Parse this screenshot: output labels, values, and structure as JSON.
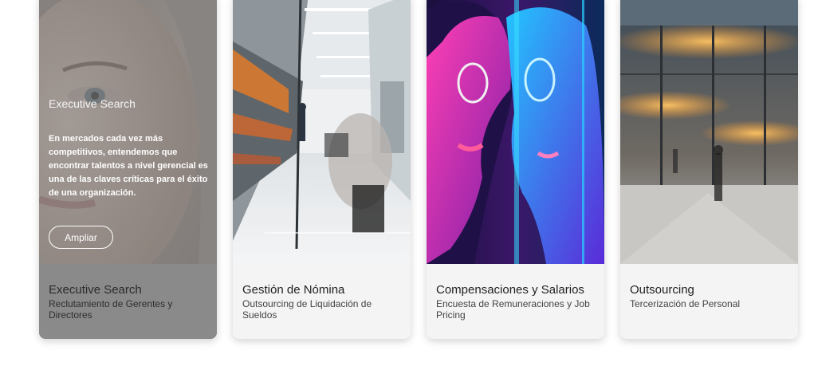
{
  "cards": [
    {
      "title": "Executive Search",
      "subtitle": "Reclutamiento de Gerentes y Directores",
      "overlay": {
        "title": "Executive Search",
        "text": "En mercados cada vez más competitivos, entendemos que encontrar talentos a nivel gerencial es una de las claves críticas para el éxito de una organización.",
        "button_label": "Ampliar"
      }
    },
    {
      "title": "Gestión de Nómina",
      "subtitle": "Outsourcing de Liquidación de Sueldos"
    },
    {
      "title": "Compensaciones y Salarios",
      "subtitle": "Encuesta de Remuneraciones y Job Pricing"
    },
    {
      "title": "Outsourcing",
      "subtitle": "Tercerización de Personal"
    }
  ]
}
